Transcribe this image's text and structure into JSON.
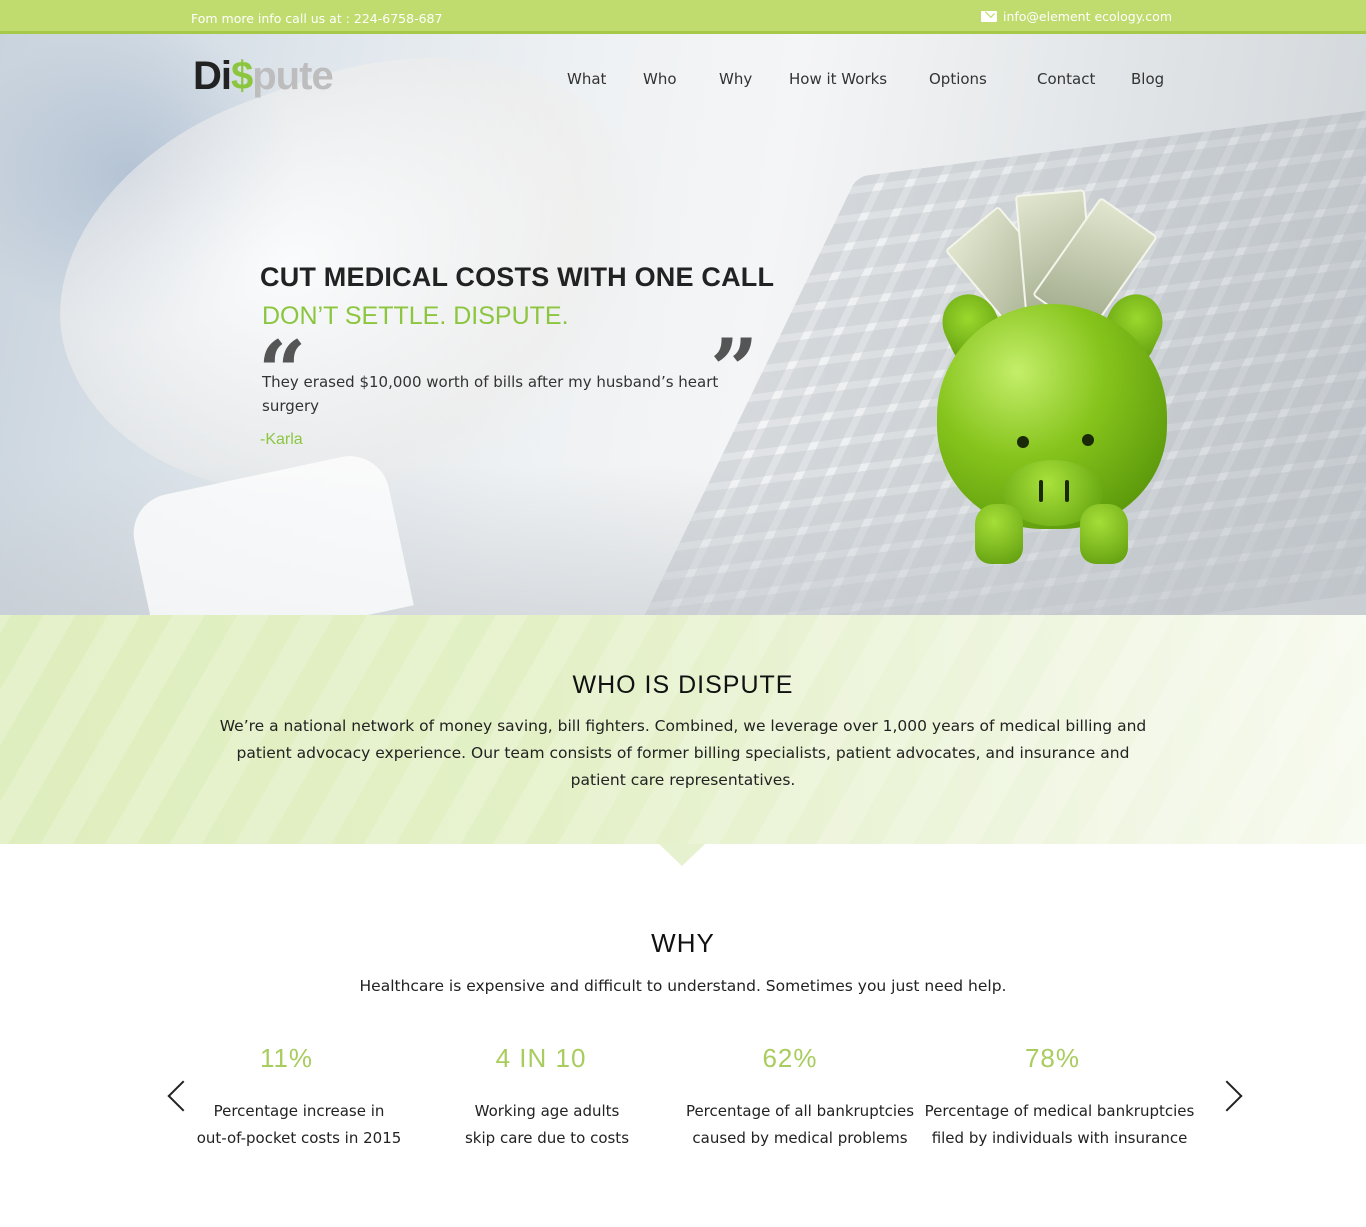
{
  "topbar": {
    "phone_text": "Fom more info call us at : 224-6758-687",
    "email_text": "info@element ecology.com",
    "email_icon": "mail-icon"
  },
  "logo": {
    "part1": "Di",
    "part2": "$",
    "part3": "pute"
  },
  "nav": {
    "items": [
      {
        "label": "What"
      },
      {
        "label": "Who"
      },
      {
        "label": "Why"
      },
      {
        "label": "How it Works"
      },
      {
        "label": "Options"
      },
      {
        "label": "Contact"
      },
      {
        "label": "Blog"
      }
    ]
  },
  "hero": {
    "headline": "CUT MEDICAL COSTS WITH ONE CALL",
    "subhead": "DON’T SETTLE. DISPUTE.",
    "quote_open": "“",
    "quote_close": "”",
    "testimonial": "They erased $10,000 worth of bills after my husband’s heart surgery",
    "author": "-Karla",
    "image_icon": "piggy-bank-icon"
  },
  "who": {
    "title": "WHO IS DISPUTE",
    "text": "We’re a national network of money saving, bill fighters. Combined, we leverage over 1,000 years of medical billing and patient advocacy experience.  Our team consists of former billing specialists, patient advocates, and insurance and patient care representatives."
  },
  "why": {
    "title": "WHY",
    "subtitle": "Healthcare is expensive and difficult to understand.  Sometimes you just need help.",
    "stats": [
      {
        "value": "11%",
        "desc": "Percentage increase in\nout-of-pocket costs in 2015"
      },
      {
        "value": "4 IN 10",
        "desc": "Working age adults\nskip care due to costs"
      },
      {
        "value": "62%",
        "desc": "Percentage of all bankruptcies\ncaused by medical problems"
      },
      {
        "value": "78%",
        "desc": "Percentage of medical bankruptcies\nfiled by individuals with insurance"
      }
    ],
    "prev_icon": "chevron-left-icon",
    "next_icon": "chevron-right-icon"
  },
  "colors": {
    "brand_green": "#8cc63f",
    "topbar_green": "#c0db6e",
    "stat_green": "#a9cc5e"
  }
}
